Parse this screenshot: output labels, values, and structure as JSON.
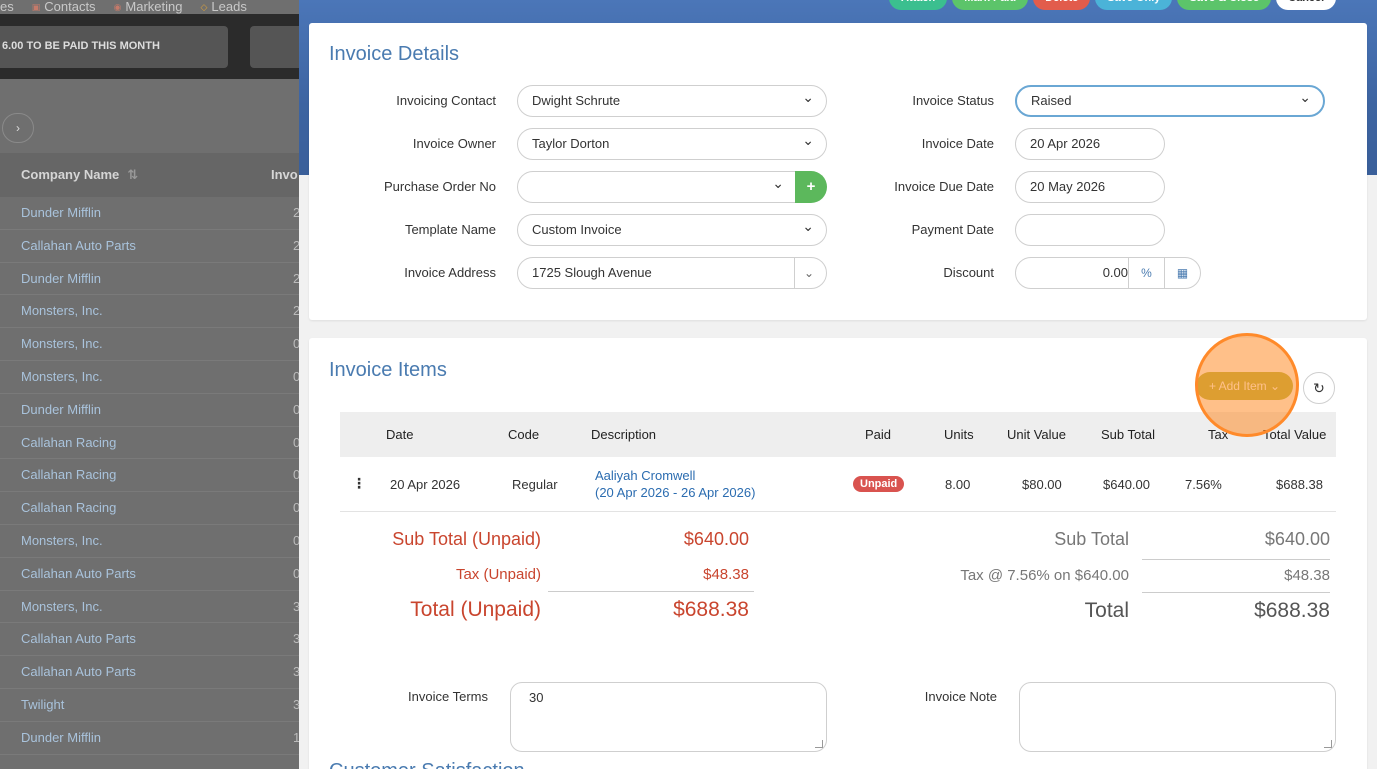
{
  "background": {
    "nav": [
      {
        "label": "es",
        "icon": ""
      },
      {
        "label": "Contacts",
        "icon": "contacts-icon"
      },
      {
        "label": "Marketing",
        "icon": "broadcast-icon"
      },
      {
        "label": "Leads",
        "icon": "diamond-icon"
      }
    ],
    "banner_text": "6.00 TO BE PAID THIS MONTH",
    "pager_label": "›",
    "columns": {
      "company": "Company Name",
      "sort_icon": "⇅",
      "invoice": "Invo"
    },
    "rows": [
      {
        "company": "Dunder Mifflin",
        "n": "2"
      },
      {
        "company": "Callahan Auto Parts",
        "n": "2"
      },
      {
        "company": "Dunder Mifflin",
        "n": "2"
      },
      {
        "company": "Monsters, Inc.",
        "n": "2"
      },
      {
        "company": "Monsters, Inc.",
        "n": "0"
      },
      {
        "company": "Monsters, Inc.",
        "n": "0"
      },
      {
        "company": "Dunder Mifflin",
        "n": "0"
      },
      {
        "company": "Callahan Racing",
        "n": "0"
      },
      {
        "company": "Callahan Racing",
        "n": "0"
      },
      {
        "company": "Callahan Racing",
        "n": "0"
      },
      {
        "company": "Monsters, Inc.",
        "n": "0"
      },
      {
        "company": "Callahan Auto Parts",
        "n": "0"
      },
      {
        "company": "Monsters, Inc.",
        "n": "3"
      },
      {
        "company": "Callahan Auto Parts",
        "n": "3"
      },
      {
        "company": "Callahan Auto Parts",
        "n": "3"
      },
      {
        "company": "Twilight",
        "n": "3"
      },
      {
        "company": "Dunder Mifflin",
        "n": "1"
      }
    ]
  },
  "top_buttons": [
    {
      "label": "Attach",
      "color": "#3bbf8f"
    },
    {
      "label": "Mark Paid",
      "color": "#5cc46a"
    },
    {
      "label": "Delete",
      "color": "#e25c4c"
    },
    {
      "label": "Save Only",
      "color": "#4bb3d8"
    },
    {
      "label": "Save & Close",
      "color": "#5cc46a"
    },
    {
      "label": "Cancel",
      "color": "#ffffff"
    }
  ],
  "details": {
    "title": "Invoice Details",
    "invoicing_contact": {
      "label": "Invoicing Contact",
      "value": "Dwight Schrute"
    },
    "invoice_owner": {
      "label": "Invoice Owner",
      "value": "Taylor Dorton"
    },
    "purchase_order": {
      "label": "Purchase Order No",
      "value": "",
      "add": "+"
    },
    "template_name": {
      "label": "Template Name",
      "value": "Custom Invoice"
    },
    "invoice_address": {
      "label": "Invoice Address",
      "value": "1725 Slough Avenue"
    },
    "invoice_status": {
      "label": "Invoice Status",
      "value": "Raised"
    },
    "invoice_date": {
      "label": "Invoice Date",
      "value": "20 Apr 2026"
    },
    "invoice_due_date": {
      "label": "Invoice Due Date",
      "value": "20 May 2026"
    },
    "payment_date": {
      "label": "Payment Date",
      "value": ""
    },
    "discount": {
      "label": "Discount",
      "value": "0.00",
      "percent": "%",
      "calc_icon": "calculator-icon"
    }
  },
  "items": {
    "title": "Invoice Items",
    "add_item_label": "+ Add Item ⌄",
    "refresh_icon": "refresh-icon",
    "columns": [
      "Date",
      "Code",
      "Description",
      "Paid",
      "Units",
      "Unit Value",
      "Sub Total",
      "Tax",
      "Total Value"
    ],
    "rows": [
      {
        "date": "20 Apr 2026",
        "code": "Regular",
        "description": "Aaliyah Cromwell",
        "description_sub": "(20 Apr 2026 - 26 Apr 2026)",
        "paid": "Unpaid",
        "units": "8.00",
        "unit_value": "$80.00",
        "sub_total": "$640.00",
        "tax": "7.56%",
        "total_value": "$688.38"
      }
    ],
    "unpaid": {
      "sub_total_label": "Sub Total (Unpaid)",
      "sub_total": "$640.00",
      "tax_label": "Tax (Unpaid)",
      "tax": "$48.38",
      "total_label": "Total (Unpaid)",
      "total": "$688.38"
    },
    "summary": {
      "sub_total_label": "Sub Total",
      "sub_total": "$640.00",
      "tax_label": "Tax @ 7.56% on $640.00",
      "tax": "$48.38",
      "total_label": "Total",
      "total": "$688.38"
    },
    "terms": {
      "label": "Invoice Terms",
      "value": "30"
    },
    "note": {
      "label": "Invoice Note",
      "value": ""
    },
    "next_section": "Customer Satisfaction"
  }
}
